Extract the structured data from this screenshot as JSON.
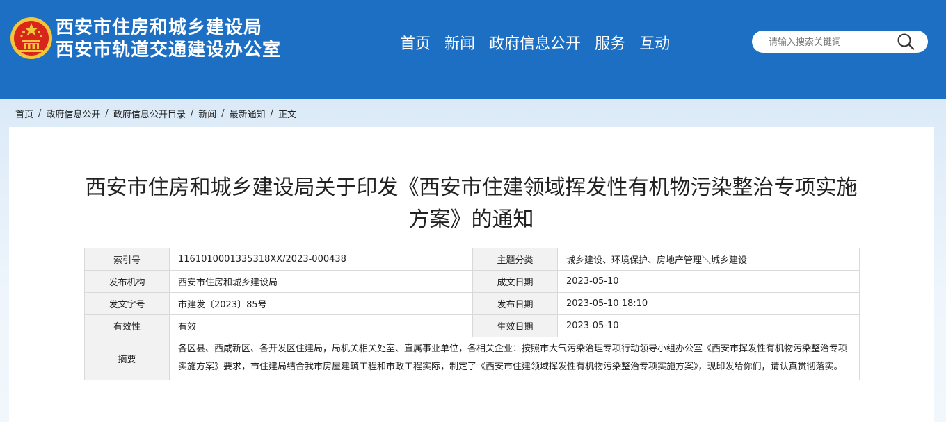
{
  "header": {
    "org_name_1": "西安市住房和城乡建设局",
    "org_name_2": "西安市轨道交通建设办公室",
    "nav": [
      "首页",
      "新闻",
      "政府信息公开",
      "服务",
      "互动"
    ],
    "search_placeholder": "请输入搜索关键词",
    "colors": {
      "brand_blue": "#1d6fc4",
      "emblem_red": "#d8261c",
      "emblem_gold": "#f3c53b"
    }
  },
  "breadcrumb": [
    "首页",
    "政府信息公开",
    "政府信息公开目录",
    "新闻",
    "最新通知",
    "正文"
  ],
  "article": {
    "title": "西安市住房和城乡建设局关于印发《西安市住建领域挥发性有机物污染整治专项实施方案》的通知"
  },
  "meta": {
    "rows": [
      [
        {
          "label": "索引号",
          "value": "1161010001335318XX/2023-000438"
        },
        {
          "label": "主题分类",
          "value": "城乡建设、环境保护、房地产管理＼城乡建设"
        }
      ],
      [
        {
          "label": "发布机构",
          "value": "西安市住房和城乡建设局"
        },
        {
          "label": "成文日期",
          "value": "2023-05-10"
        }
      ],
      [
        {
          "label": "发文字号",
          "value": "市建发〔2023〕85号"
        },
        {
          "label": "发布日期",
          "value": "2023-05-10 18:10"
        }
      ],
      [
        {
          "label": "有效性",
          "value": "有效"
        },
        {
          "label": "生效日期",
          "value": "2023-05-10"
        }
      ]
    ],
    "summary_label": "摘要",
    "summary": "各区县、西咸新区、各开发区住建局，局机关相关处室、直属事业单位，各相关企业：按照市大气污染治理专项行动领导小组办公室《西安市挥发性有机物污染整治专项实施方案》要求，市住建局结合我市房屋建筑工程和市政工程实际，制定了《西安市住建领域挥发性有机物污染整治专项实施方案》，现印发给你们，请认真贯彻落实。"
  }
}
